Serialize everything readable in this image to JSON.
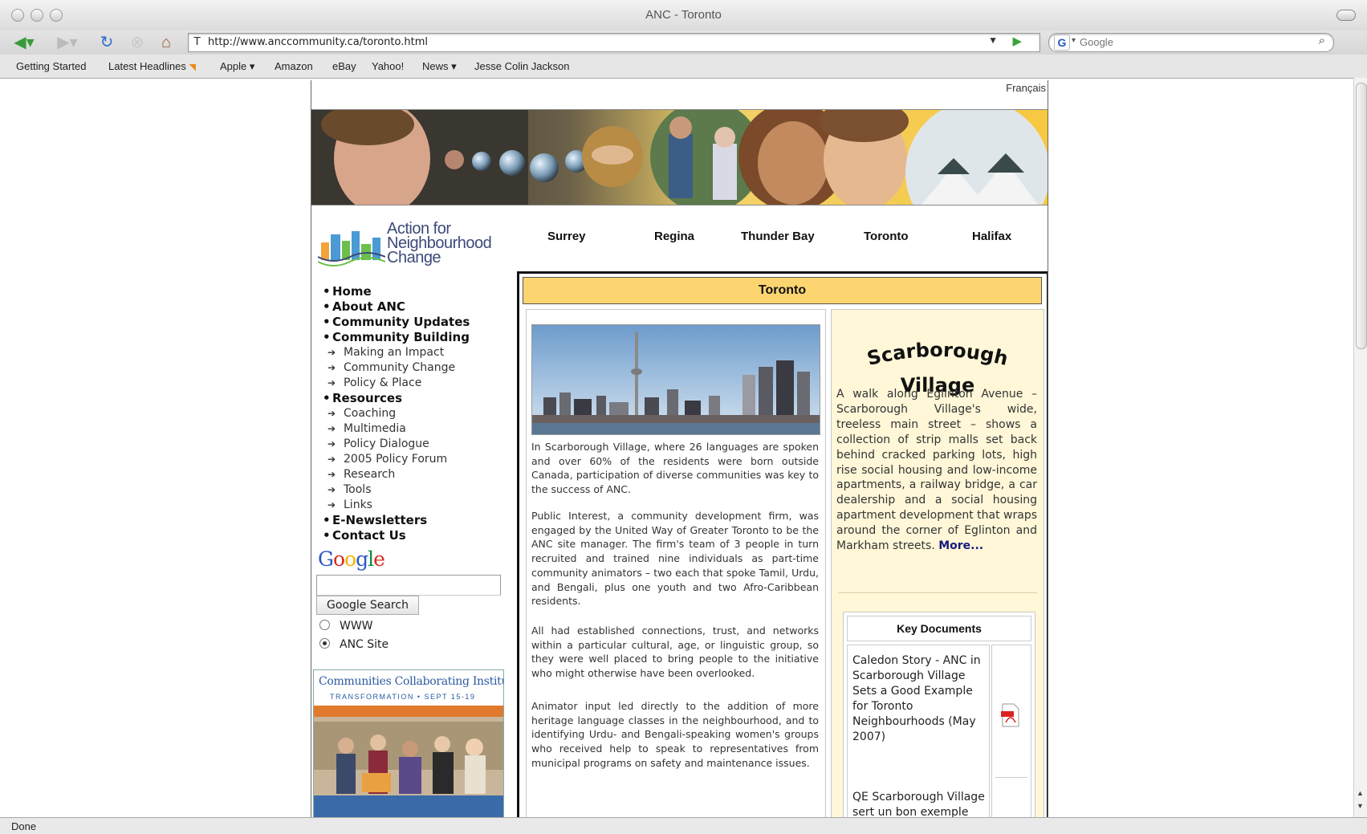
{
  "window": {
    "title": "ANC - Toronto"
  },
  "toolbar": {
    "url": "http://www.anccommunity.ca/toronto.html",
    "search_placeholder": "Google"
  },
  "bookmarks": [
    {
      "label": "Getting Started"
    },
    {
      "label": "Latest Headlines"
    },
    {
      "label": "Apple ▾"
    },
    {
      "label": "Amazon"
    },
    {
      "label": "eBay"
    },
    {
      "label": "Yahoo!"
    },
    {
      "label": "News ▾"
    },
    {
      "label": "Jesse Colin Jackson"
    }
  ],
  "status": {
    "text": "Done"
  },
  "page": {
    "language_link": "Français",
    "logo_lines": [
      "Action for",
      "Neighbourhood",
      "Change"
    ],
    "top_nav": [
      "Surrey",
      "Regina",
      "Thunder Bay",
      "Toronto",
      "Halifax"
    ],
    "left_nav": [
      {
        "label": "Home",
        "level": 1
      },
      {
        "label": "About ANC",
        "level": 1
      },
      {
        "label": "Community Updates",
        "level": 1
      },
      {
        "label": "Community Building",
        "level": 1
      },
      {
        "label": "Making an Impact",
        "level": 2
      },
      {
        "label": "Community Change",
        "level": 2
      },
      {
        "label": "Policy & Place",
        "level": 2
      },
      {
        "label": "Resources",
        "level": 1
      },
      {
        "label": "Coaching",
        "level": 2
      },
      {
        "label": "Multimedia",
        "level": 2
      },
      {
        "label": "Policy Dialogue",
        "level": 2
      },
      {
        "label": "2005 Policy Forum",
        "level": 2
      },
      {
        "label": "Research",
        "level": 2
      },
      {
        "label": "Tools",
        "level": 2
      },
      {
        "label": "Links",
        "level": 2
      },
      {
        "label": "E-Newsletters",
        "level": 1
      },
      {
        "label": "Contact Us",
        "level": 1
      }
    ],
    "google_search": {
      "logo": "Google",
      "button": "Google Search",
      "options": [
        {
          "label": "WWW",
          "selected": false
        },
        {
          "label": "ANC Site",
          "selected": true
        }
      ]
    },
    "promo": {
      "title": "Communities Collaborating Institute",
      "subtitle": "TRANSFORMATION • SEPT 15-19"
    },
    "main_title": "Toronto",
    "paragraphs": [
      "In Scarborough Village, where 26 languages are spoken and over 60% of the residents were born outside Canada, participation of diverse communities was key to the success of ANC.",
      "Public Interest, a community development firm, was engaged by the United Way of Greater Toronto to be the ANC site manager. The firm's team of 3 people in turn recruited and trained nine individuals as part-time community animators – two each that spoke Tamil, Urdu, and Bengali, plus one youth and two Afro-Caribbean residents.",
      "All had established connections, trust, and networks within a particular cultural, age, or linguistic group, so they were well placed to bring people to the initiative who might otherwise have been overlooked.",
      "Animator input led directly to the addition of more heritage language classes in the neighbourhood, and to identifying Urdu- and Bengali-speaking women's groups who received help to speak to representatives from municipal programs on safety and maintenance issues."
    ],
    "sidebar": {
      "title_line1": "Scarborough",
      "title_line2": "Village",
      "text": "A walk along Eglinton Avenue – Scarborough Village's wide, treeless main street – shows a collection of strip malls set back behind cracked parking lots, high rise social housing and low-income apartments, a railway bridge, a car dealership and a social housing apartment development that wraps around the corner of Eglinton and Markham streets.",
      "more": "More..."
    },
    "key_documents": {
      "title": "Key Documents",
      "items": [
        {
          "text": "Caledon Story - ANC in Scarborough Village Sets a Good Example for Toronto Neighbourhoods (May 2007)"
        },
        {
          "text": "QE Scarborough Village sert un bon exemple aux autres"
        }
      ]
    }
  },
  "colors": {
    "header_yellow": "#fcd570",
    "sidebar_bg": "#fff7d8",
    "link_navy": "#1a1a7a"
  }
}
